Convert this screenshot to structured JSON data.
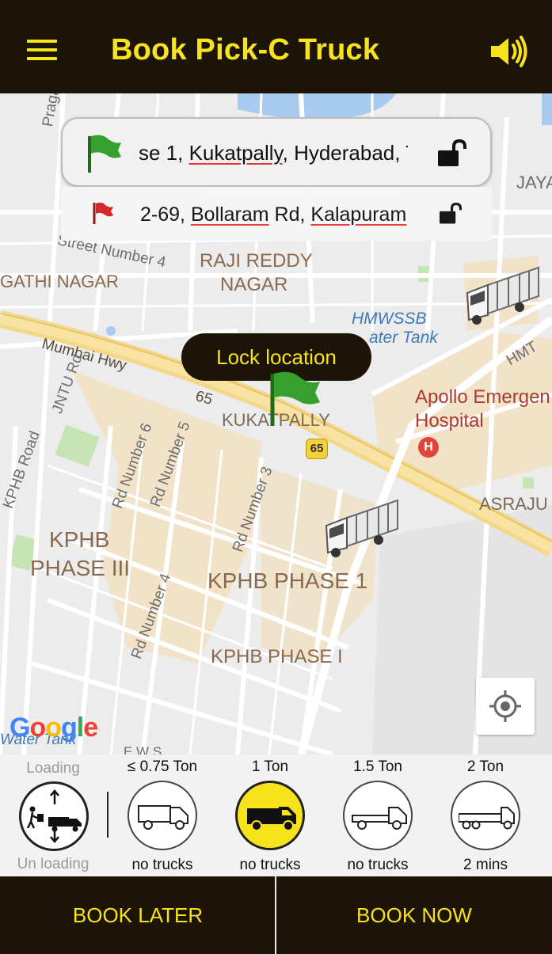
{
  "header": {
    "title": "Book Pick-C Truck",
    "menu_icon": "hamburger-menu-icon",
    "sound_icon": "speaker-volume-icon"
  },
  "locations": {
    "pickup": {
      "prefix": "se 1, ",
      "underlined": "Kukatpally",
      "suffix": ", Hyderabad, T",
      "flag_color": "#2f8f2a",
      "lock_icon": "unlocked-padlock-icon"
    },
    "drop": {
      "prefix": "2-69, ",
      "underlined_1": "Bollaram",
      "middle": " Rd, ",
      "underlined_2": "Kalapuram",
      "flag_color": "#d81f1f",
      "lock_icon": "unlocked-padlock-icon"
    }
  },
  "map": {
    "lock_location_label": "Lock location",
    "labels": {
      "raji_reddy_1": "RAJI REDDY",
      "raji_reddy_2": "NAGAR",
      "gathi_nagar": "GATHI NAGAR",
      "street_number_4": "Street Number 4",
      "mumbai_hwy": "Mumbai Hwy",
      "hmwssb": "HMWSSB",
      "water_tank": "ater Tank",
      "apollo_1": "Apollo Emergen",
      "apollo_2": "Hospital",
      "kukatpally": "KUKATPALLY",
      "hwy_65_a": "65",
      "hwy_65_shield": "65",
      "jntu_rd": "JNTU Rd",
      "kphb_road": "KPHB Road",
      "rd_number_6": "Rd Number 6",
      "rd_number_5": "Rd Number 5",
      "rd_number_3": "Rd Number 3",
      "rd_number_4": "Rd Number 4",
      "kphb_phase_3_1": "KPHB",
      "kphb_phase_3_2": "PHASE III",
      "kphb_phase_1": "KPHB PHASE 1",
      "kphb_phase_i": "KPHB PHASE I",
      "asraju": "ASRAJU",
      "jaya": "JAYA",
      "hmt": "HMT",
      "pragathi": "Pragathi N",
      "google": "Google",
      "water_tank_bottom": "Water Tank",
      "ews": "E W S"
    }
  },
  "selector": {
    "loading_label": "Loading",
    "unloading_label": "Un loading",
    "options": [
      {
        "capacity": "≤ 0.75 Ton",
        "status": "no trucks",
        "icon": "mini-truck-icon"
      },
      {
        "capacity": "1 Ton",
        "status": "no trucks",
        "icon": "pickup-truck-icon"
      },
      {
        "capacity": "1.5 Ton",
        "status": "no trucks",
        "icon": "flatbed-truck-icon"
      },
      {
        "capacity": "2 Ton",
        "status": "2 mins",
        "icon": "long-truck-icon"
      }
    ],
    "active_index": 1
  },
  "actions": {
    "book_later": "BOOK LATER",
    "book_now": "BOOK NOW"
  },
  "colors": {
    "brand_dark": "#1c1407",
    "brand_yellow": "#f7e31a"
  }
}
